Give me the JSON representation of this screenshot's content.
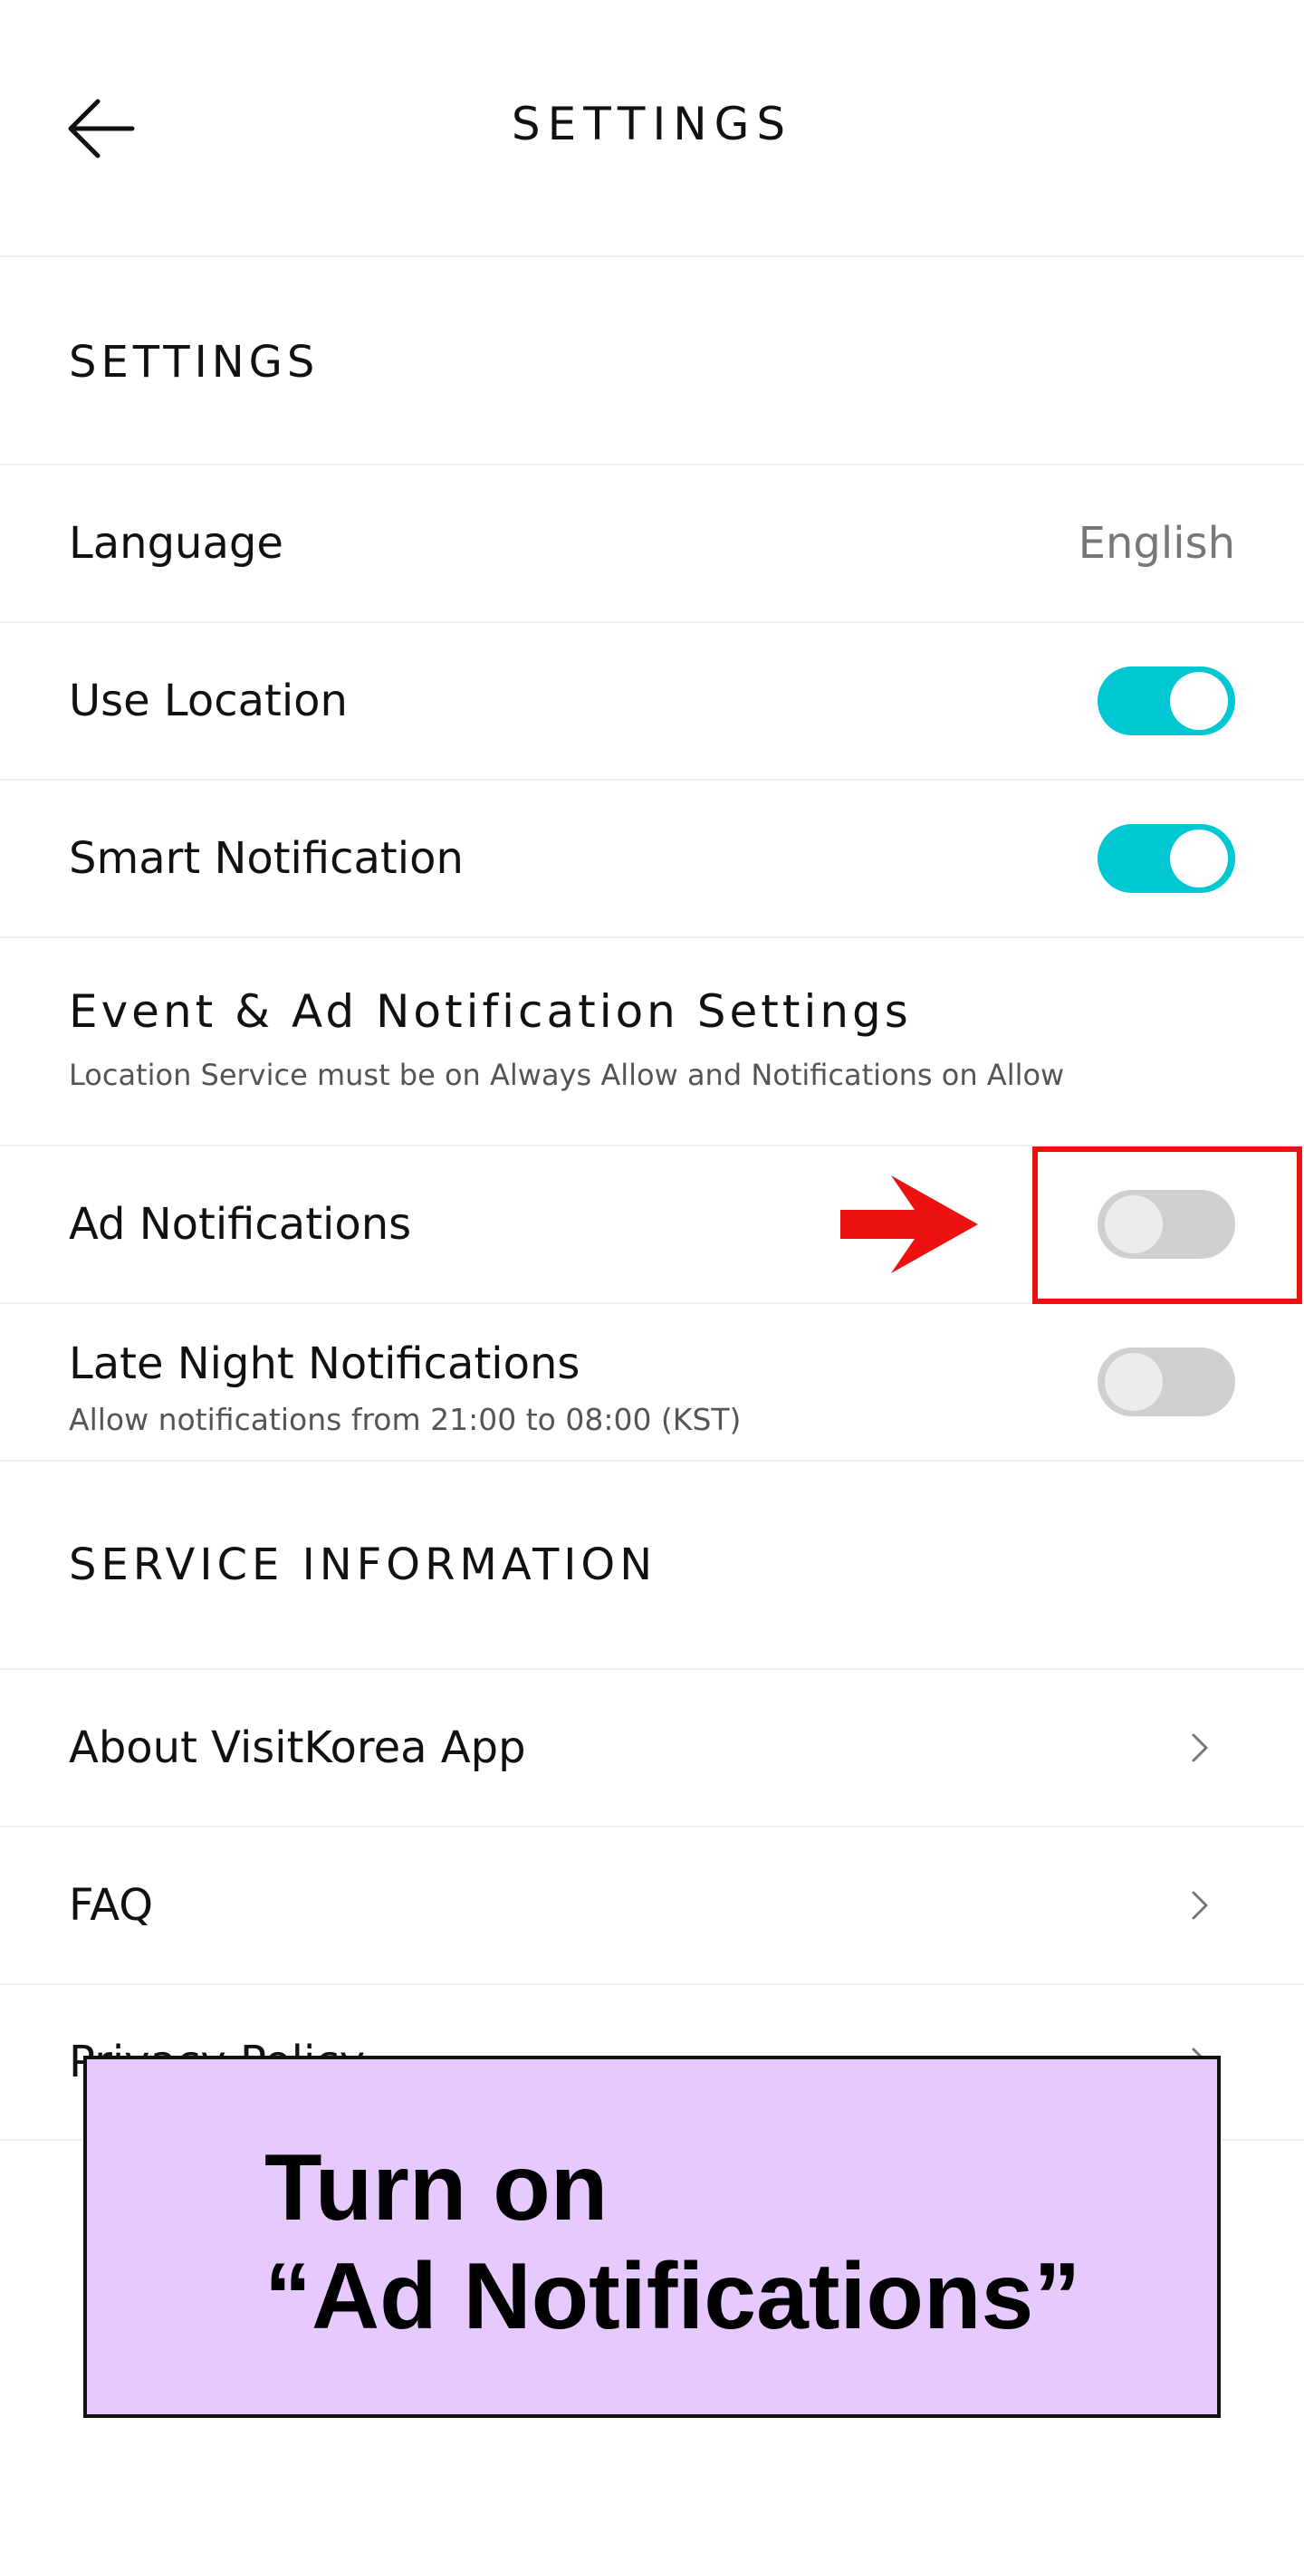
{
  "header": {
    "title": "SETTINGS",
    "back_icon": "arrow-left-icon"
  },
  "settings_section": {
    "heading": "SETTINGS",
    "language": {
      "label": "Language",
      "value": "English"
    },
    "use_location": {
      "label": "Use Location",
      "enabled": true
    },
    "smart_notification": {
      "label": "Smart Notification",
      "enabled": true
    }
  },
  "event_section": {
    "heading": "Event & Ad Notification Settings",
    "note": "Location Service must be on Always Allow and Notifications on Allow",
    "ad_notifications": {
      "label": "Ad Notifications",
      "enabled": false
    },
    "late_night": {
      "label": "Late Night Notifications",
      "sub": "Allow notifications from 21:00 to 08:00 (KST)",
      "enabled": false
    }
  },
  "service_section": {
    "heading": "SERVICE INFORMATION",
    "items": [
      {
        "label": "About VisitKorea App"
      },
      {
        "label": "FAQ"
      },
      {
        "label": "Privacy Policy"
      }
    ]
  },
  "instruction": {
    "line1": "Turn on",
    "line2": "“Ad Notifications”"
  },
  "colors": {
    "toggle_on": "#00c8d2",
    "toggle_off": "#cfcfcf",
    "annotation_red": "#ee1111",
    "card_bg": "#e6caff"
  }
}
